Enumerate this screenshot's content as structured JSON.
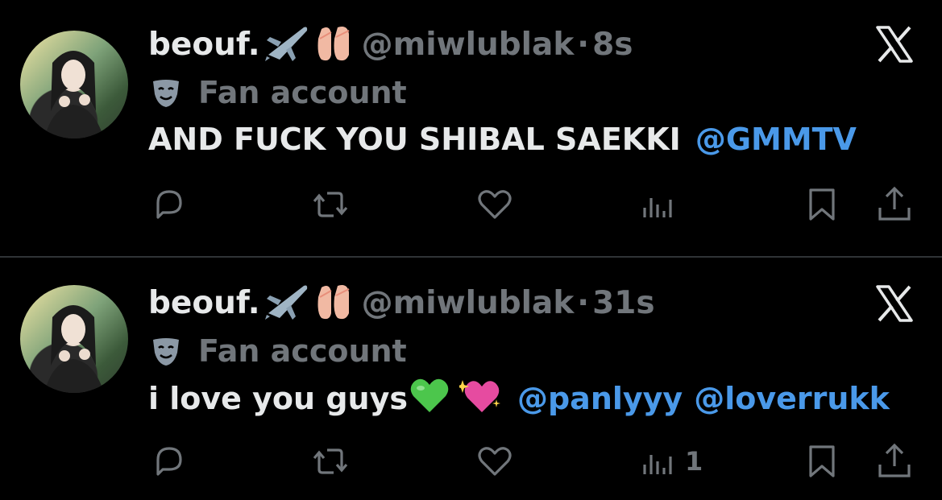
{
  "tweets": [
    {
      "display_name": "beouf.",
      "handle": "@miwlublak",
      "separator": "·",
      "time": "8s",
      "label": "Fan account",
      "text": "AND FUCK YOU SHIBAL SAEKKI",
      "mentions": [
        "@GMMTV"
      ],
      "views_count": ""
    },
    {
      "display_name": "beouf.",
      "handle": "@miwlublak",
      "separator": "·",
      "time": "31s",
      "label": "Fan account",
      "text": "i love you guys",
      "mentions": [
        "@panlyyy",
        "@loverrukk"
      ],
      "views_count": "1"
    }
  ],
  "colors": {
    "background": "#000000",
    "text": "#e7e9ea",
    "muted": "#71767b",
    "link": "#4a99e9",
    "divider": "#2f3336"
  },
  "icons": [
    "reply-icon",
    "retweet-icon",
    "like-icon",
    "views-icon",
    "bookmark-icon",
    "share-icon",
    "x-logo-icon",
    "theater-mask-icon",
    "airplane-emoji",
    "ballet-shoes-emoji",
    "green-heart-emoji",
    "sparkling-heart-emoji"
  ]
}
